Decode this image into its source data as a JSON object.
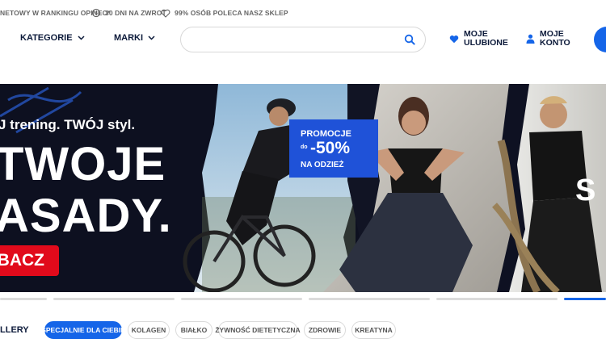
{
  "topbar": {
    "items": [
      {
        "icon": "chart-icon",
        "text": "NETOWY W RANKINGU OPINEO*"
      },
      {
        "icon": "return-clock-icon",
        "text": "30 DNI NA ZWROT"
      },
      {
        "icon": "heart-outline-icon",
        "text": "99% OSÓB POLECA NASZ SKLEP"
      }
    ]
  },
  "header": {
    "categories_label": "KATEGORIE",
    "brands_label": "MARKI",
    "search": {
      "value": "",
      "placeholder": ""
    },
    "favorites": {
      "line1": "MOJE",
      "line2": "ULUBIONE"
    },
    "account": {
      "line1": "MOJE",
      "line2": "KONTO"
    }
  },
  "banner": {
    "tagline": "J trening. TWÓJ styl.",
    "headline_line1": "TWOJE",
    "headline_line2": "ASADY.",
    "promo": {
      "line1": "PROMOCJE",
      "prefix": "do",
      "discount": "-50%",
      "line3": "NA ODZIEŻ"
    },
    "cta_label": "BACZ",
    "right_partial": "S"
  },
  "slider": {
    "count": 5,
    "active_index": 4
  },
  "chips": {
    "title": "LLERY",
    "items": [
      {
        "label": "SPECJALNIE DLA CIEBIE",
        "active": true
      },
      {
        "label": "KOLAGEN",
        "active": false
      },
      {
        "label": "BIAŁKO",
        "active": false
      },
      {
        "label": "ŻYWNOŚĆ DIETETYCZNA",
        "active": false
      },
      {
        "label": "ZDROWIE",
        "active": false
      },
      {
        "label": "KREATYNA",
        "active": false
      }
    ]
  },
  "colors": {
    "accent": "#1565e8",
    "cta": "#e10a1b",
    "navy": "#0c1a3a",
    "promo": "#1f52d8"
  }
}
